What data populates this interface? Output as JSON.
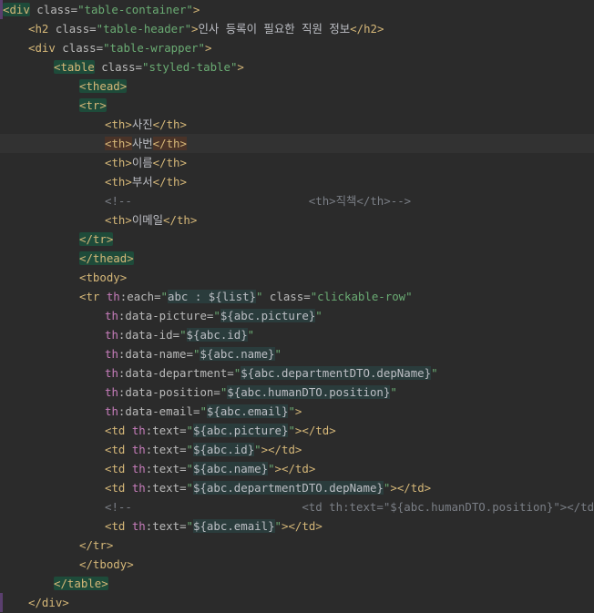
{
  "editor": {
    "language": "html",
    "lines": [
      {
        "indent": 0,
        "tokens": [
          [
            "tag",
            "<div",
            true
          ],
          [
            "attr",
            " class="
          ],
          [
            "str",
            "\"table-container\""
          ],
          [
            "tag",
            ">"
          ]
        ]
      },
      {
        "indent": 1,
        "tokens": [
          [
            "tag",
            "<h2"
          ],
          [
            "attr",
            " class="
          ],
          [
            "str",
            "\"table-header\""
          ],
          [
            "tag",
            ">"
          ],
          [
            "text",
            "인사 등록이 필요한 직원 정보"
          ],
          [
            "tag",
            "</h2>"
          ]
        ]
      },
      {
        "indent": 1,
        "tokens": [
          [
            "tag",
            "<div"
          ],
          [
            "attr",
            " class="
          ],
          [
            "str",
            "\"table-wrapper\""
          ],
          [
            "tag",
            ">"
          ]
        ]
      },
      {
        "indent": 2,
        "tokens": [
          [
            "tag",
            "<table",
            true
          ],
          [
            "attr",
            " class="
          ],
          [
            "str",
            "\"styled-table\""
          ],
          [
            "tag",
            ">"
          ]
        ]
      },
      {
        "indent": 3,
        "tokens": [
          [
            "tag",
            "<thead>",
            true
          ]
        ]
      },
      {
        "indent": 3,
        "tokens": [
          [
            "tag",
            "<tr>",
            true
          ]
        ]
      },
      {
        "indent": 4,
        "tokens": [
          [
            "tag",
            "<th>"
          ],
          [
            "text",
            "사진"
          ],
          [
            "tag",
            "</th>"
          ]
        ]
      },
      {
        "indent": 4,
        "current": true,
        "tokens": [
          [
            "tag",
            "<th>",
            "warn"
          ],
          [
            "text",
            "사번"
          ],
          [
            "tag",
            "</th>",
            "warn"
          ]
        ]
      },
      {
        "indent": 4,
        "tokens": [
          [
            "tag",
            "<th>"
          ],
          [
            "text",
            "이름"
          ],
          [
            "tag",
            "</th>"
          ]
        ]
      },
      {
        "indent": 4,
        "tokens": [
          [
            "tag",
            "<th>"
          ],
          [
            "text",
            "부서"
          ],
          [
            "tag",
            "</th>"
          ]
        ]
      },
      {
        "indent": 4,
        "tokens": [
          [
            "cmt",
            "<!--                          <th>직책</th>-->"
          ]
        ]
      },
      {
        "indent": 4,
        "tokens": [
          [
            "tag",
            "<th>"
          ],
          [
            "text",
            "이메일"
          ],
          [
            "tag",
            "</th>"
          ]
        ]
      },
      {
        "indent": 3,
        "tokens": [
          [
            "tag",
            "</tr>",
            true
          ]
        ]
      },
      {
        "indent": 3,
        "tokens": [
          [
            "tag",
            "</thead>",
            true
          ]
        ]
      },
      {
        "indent": 3,
        "tokens": [
          [
            "tag",
            "<tbody>"
          ]
        ]
      },
      {
        "indent": 3,
        "tokens": [
          [
            "tag",
            "<tr"
          ],
          [
            "th",
            " th"
          ],
          [
            "attr",
            ":each="
          ],
          [
            "str",
            "\""
          ],
          [
            "expr",
            "abc : ${list}",
            true
          ],
          [
            "str",
            "\""
          ],
          [
            "attr",
            " class="
          ],
          [
            "str",
            "\"clickable-row\""
          ]
        ]
      },
      {
        "indent": 4,
        "tokens": [
          [
            "th",
            "th"
          ],
          [
            "attr",
            ":data-picture="
          ],
          [
            "str",
            "\""
          ],
          [
            "expr",
            "${abc.picture}",
            true
          ],
          [
            "str",
            "\""
          ]
        ]
      },
      {
        "indent": 4,
        "tokens": [
          [
            "th",
            "th"
          ],
          [
            "attr",
            ":data-id="
          ],
          [
            "str",
            "\""
          ],
          [
            "expr",
            "${abc.id}",
            true
          ],
          [
            "str",
            "\""
          ]
        ]
      },
      {
        "indent": 4,
        "tokens": [
          [
            "th",
            "th"
          ],
          [
            "attr",
            ":data-name="
          ],
          [
            "str",
            "\""
          ],
          [
            "expr",
            "${abc.name}",
            true
          ],
          [
            "str",
            "\""
          ]
        ]
      },
      {
        "indent": 4,
        "tokens": [
          [
            "th",
            "th"
          ],
          [
            "attr",
            ":data-department="
          ],
          [
            "str",
            "\""
          ],
          [
            "expr",
            "${abc.departmentDTO.depName}",
            true
          ],
          [
            "str",
            "\""
          ]
        ]
      },
      {
        "indent": 4,
        "tokens": [
          [
            "th",
            "th"
          ],
          [
            "attr",
            ":data-position="
          ],
          [
            "str",
            "\""
          ],
          [
            "expr",
            "${abc.humanDTO.position}",
            true
          ],
          [
            "str",
            "\""
          ]
        ]
      },
      {
        "indent": 4,
        "tokens": [
          [
            "th",
            "th"
          ],
          [
            "attr",
            ":data-email="
          ],
          [
            "str",
            "\""
          ],
          [
            "expr",
            "${abc.email}",
            true
          ],
          [
            "str",
            "\""
          ],
          [
            "tag",
            ">"
          ]
        ]
      },
      {
        "indent": 4,
        "tokens": [
          [
            "tag",
            "<td"
          ],
          [
            "th",
            " th"
          ],
          [
            "attr",
            ":text="
          ],
          [
            "str",
            "\""
          ],
          [
            "expr",
            "${abc.picture}",
            true
          ],
          [
            "str",
            "\""
          ],
          [
            "tag",
            "></td>"
          ]
        ]
      },
      {
        "indent": 4,
        "tokens": [
          [
            "tag",
            "<td"
          ],
          [
            "th",
            " th"
          ],
          [
            "attr",
            ":text="
          ],
          [
            "str",
            "\""
          ],
          [
            "expr",
            "${abc.id}",
            true
          ],
          [
            "str",
            "\""
          ],
          [
            "tag",
            "></td>"
          ]
        ]
      },
      {
        "indent": 4,
        "tokens": [
          [
            "tag",
            "<td"
          ],
          [
            "th",
            " th"
          ],
          [
            "attr",
            ":text="
          ],
          [
            "str",
            "\""
          ],
          [
            "expr",
            "${abc.name}",
            true
          ],
          [
            "str",
            "\""
          ],
          [
            "tag",
            "></td>"
          ]
        ]
      },
      {
        "indent": 4,
        "tokens": [
          [
            "tag",
            "<td"
          ],
          [
            "th",
            " th"
          ],
          [
            "attr",
            ":text="
          ],
          [
            "str",
            "\""
          ],
          [
            "expr",
            "${abc.departmentDTO.depName}",
            true
          ],
          [
            "str",
            "\""
          ],
          [
            "tag",
            "></td>"
          ]
        ]
      },
      {
        "indent": 4,
        "tokens": [
          [
            "cmt",
            "<!--                         <td th:text=\"${abc.humanDTO.position}\"></td>-->"
          ]
        ]
      },
      {
        "indent": 4,
        "tokens": [
          [
            "tag",
            "<td"
          ],
          [
            "th",
            " th"
          ],
          [
            "attr",
            ":text="
          ],
          [
            "str",
            "\""
          ],
          [
            "expr",
            "${abc.email}",
            true
          ],
          [
            "str",
            "\""
          ],
          [
            "tag",
            "></td>"
          ]
        ]
      },
      {
        "indent": 3,
        "tokens": [
          [
            "tag",
            "</tr>"
          ]
        ]
      },
      {
        "indent": 3,
        "tokens": [
          [
            "tag",
            "</tbody>"
          ]
        ]
      },
      {
        "indent": 2,
        "tokens": [
          [
            "tag",
            "</table>",
            true
          ]
        ]
      },
      {
        "indent": 1,
        "tokens": [
          [
            "tag",
            "</div>"
          ]
        ]
      }
    ]
  },
  "colors": {
    "background": "#2b2b2b",
    "tag": "#d5b778",
    "attribute": "#bababa",
    "thymeleaf_prefix": "#c77dbb",
    "string": "#6aab73",
    "comment": "#7a7e85",
    "text": "#bcbec4"
  }
}
